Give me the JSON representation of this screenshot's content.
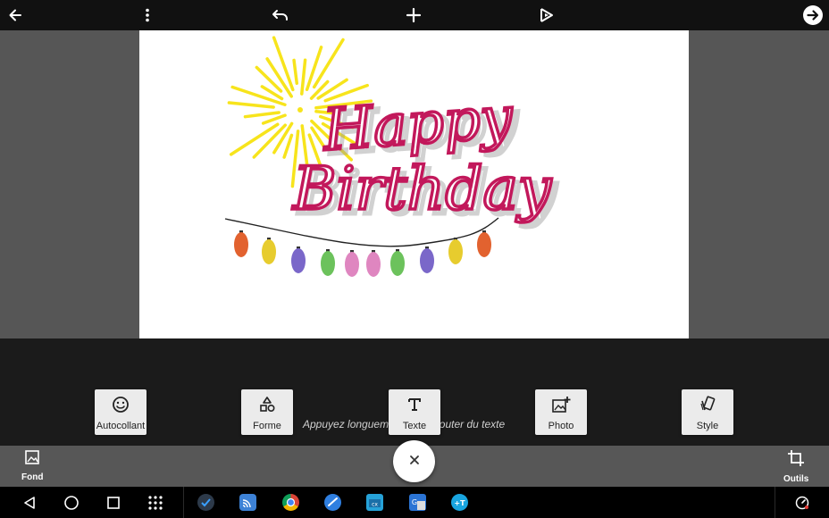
{
  "toolbar": {
    "back_icon": "arrow-left-icon",
    "menu_icon": "more-vertical-icon",
    "undo_icon": "undo-icon",
    "add_icon": "plus-icon",
    "preview_icon": "play-preview-icon",
    "next_icon": "arrow-right-circle-icon"
  },
  "canvas": {
    "headline_1": "Happy",
    "headline_2": "Birthday",
    "text_color": "#c2185b",
    "sun_color": "#f7e41c",
    "bulb_colors": [
      "#e2622f",
      "#e7cc2e",
      "#7a67c9",
      "#6cc25c",
      "#df86c0",
      "#df86c0",
      "#6cc25c",
      "#7a67c9",
      "#e7cc2e",
      "#e2622f"
    ]
  },
  "tools": {
    "hint": "Appuyez longuement pour ajouter du texte",
    "buttons": [
      {
        "label": "Autocollant",
        "icon": "smiley-icon"
      },
      {
        "label": "Forme",
        "icon": "shapes-icon"
      },
      {
        "label": "Texte",
        "icon": "text-icon"
      },
      {
        "label": "Photo",
        "icon": "add-photo-icon"
      },
      {
        "label": "Style",
        "icon": "style-icon"
      }
    ]
  },
  "bottom": {
    "fond_label": "Fond",
    "outils_label": "Outils",
    "close_icon": "close-icon"
  },
  "navbar": {
    "buttons": [
      "back-triangle-icon",
      "home-circle-icon",
      "recents-square-icon",
      "app-grid-icon"
    ],
    "apps": [
      "tasks-app-icon",
      "cast-app-icon",
      "chrome-app-icon",
      "check-app-icon",
      "cx-app-icon",
      "translate-app-icon",
      "plus-t-app-icon"
    ],
    "status_icon": "speedometer-icon"
  }
}
